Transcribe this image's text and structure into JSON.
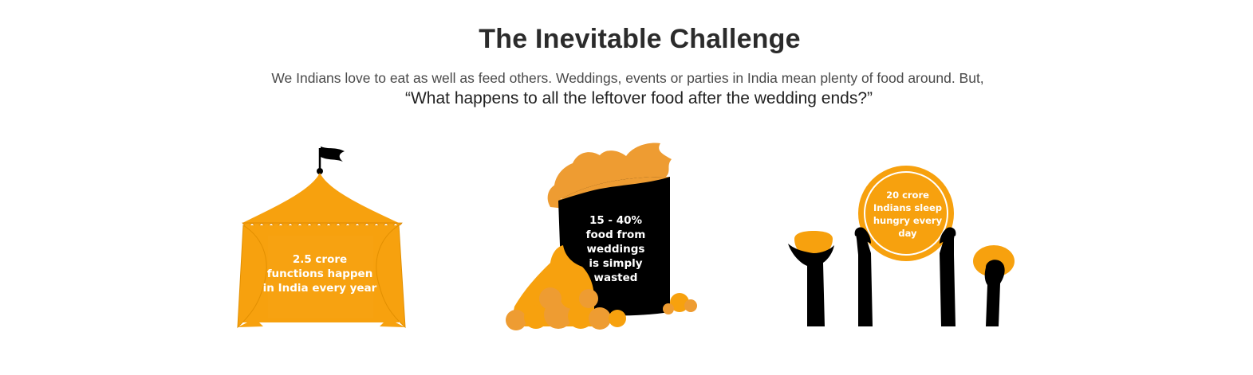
{
  "header": {
    "title": "The Inevitable Challenge",
    "intro": "We Indians love to eat as well as feed others. Weddings, events or parties in India mean plenty of food around. But,",
    "question": "“What happens to all the leftover food after the wedding ends?”"
  },
  "stats": [
    {
      "icon": "tent-icon",
      "lines": [
        "2.5 crore",
        "functions happen",
        "in India every year"
      ]
    },
    {
      "icon": "food-waste-bin-icon",
      "lines": [
        "15 - 40%",
        "food from",
        "weddings",
        "is simply",
        "wasted"
      ]
    },
    {
      "icon": "hungry-hands-icon",
      "lines": [
        "20 crore",
        "Indians sleep",
        "hungry every",
        "day"
      ]
    }
  ],
  "colors": {
    "accent": "#F7A10E",
    "accent_light": "#EE9C32",
    "dark": "#000000",
    "title": "#2B2B2B"
  }
}
